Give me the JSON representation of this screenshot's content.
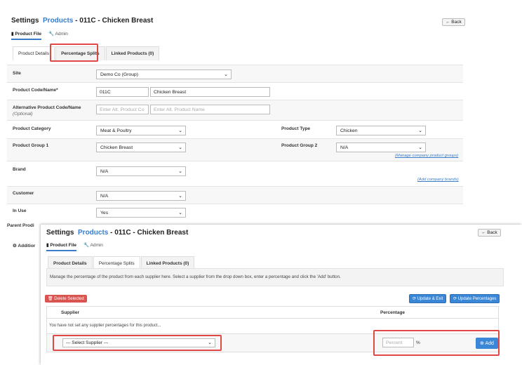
{
  "top": {
    "header": {
      "settings": "Settings",
      "products": "Products",
      "product_title": "- 011C - Chicken Breast"
    },
    "back_label": "← Back",
    "subnav": {
      "product_file": "Product File",
      "admin": "Admin"
    },
    "tabs": [
      "Product Details",
      "Percentage Splits",
      "Linked Products (0)"
    ],
    "form": {
      "site_label": "Site",
      "site_value": "Demo Co (Group)",
      "code_label": "Product Code/Name*",
      "code_value": "011C",
      "name_value": "Chicken Breast",
      "alt_label": "Alternative Product Code/Name",
      "alt_optional": "(Optional)",
      "alt_code_placeholder": "Enter Alt. Product Co",
      "alt_name_placeholder": "Enter Alt. Product Name",
      "category_label": "Product Category",
      "category_value": "Meat & Poultry",
      "type_label": "Product Type",
      "type_value": "Chicken",
      "group1_label": "Product Group 1",
      "group1_value": "Chicken Breast",
      "group2_label": "Product Group 2",
      "group2_value": "N/A",
      "manage_groups_link": "(Manage company product groups)",
      "brand_label": "Brand",
      "brand_value": "N/A",
      "add_brands_link": "(Add company brands)",
      "customer_label": "Customer",
      "customer_value": "N/A",
      "inuse_label": "In Use",
      "inuse_value": "Yes",
      "parent_label": "Parent Prodi",
      "additional_label": "Additior"
    }
  },
  "bottom": {
    "header": {
      "settings": "Settings",
      "products": "Products",
      "product_title": "- 011C - Chicken Breast"
    },
    "back_label": "← Back",
    "subnav": {
      "product_file": "Product File",
      "admin": "Admin"
    },
    "tabs": [
      "Product Details",
      "Percentage Splits",
      "Linked Products (0)"
    ],
    "info_text": "Manage the percentage of the product from each supplier here. Select a supplier from the drop down box, enter a percentage and click the 'Add' button.",
    "delete_label": "Delete Selected",
    "update_exit_label": "Update & Exit",
    "update_pct_label": "Update Percentages",
    "col_supplier": "Supplier",
    "col_percentage": "Percentage",
    "empty_text": "You have not set any supplier percentages for this product...",
    "select_supplier": "--- Select Supplier ---",
    "percent_placeholder": "Percent",
    "percent_suffix": "%",
    "add_label": "Add"
  },
  "colors": {
    "accent": "#3a7cc7",
    "highlight_box": "#e04848",
    "delete": "#d9534f",
    "primary_button": "#3a87d8"
  }
}
